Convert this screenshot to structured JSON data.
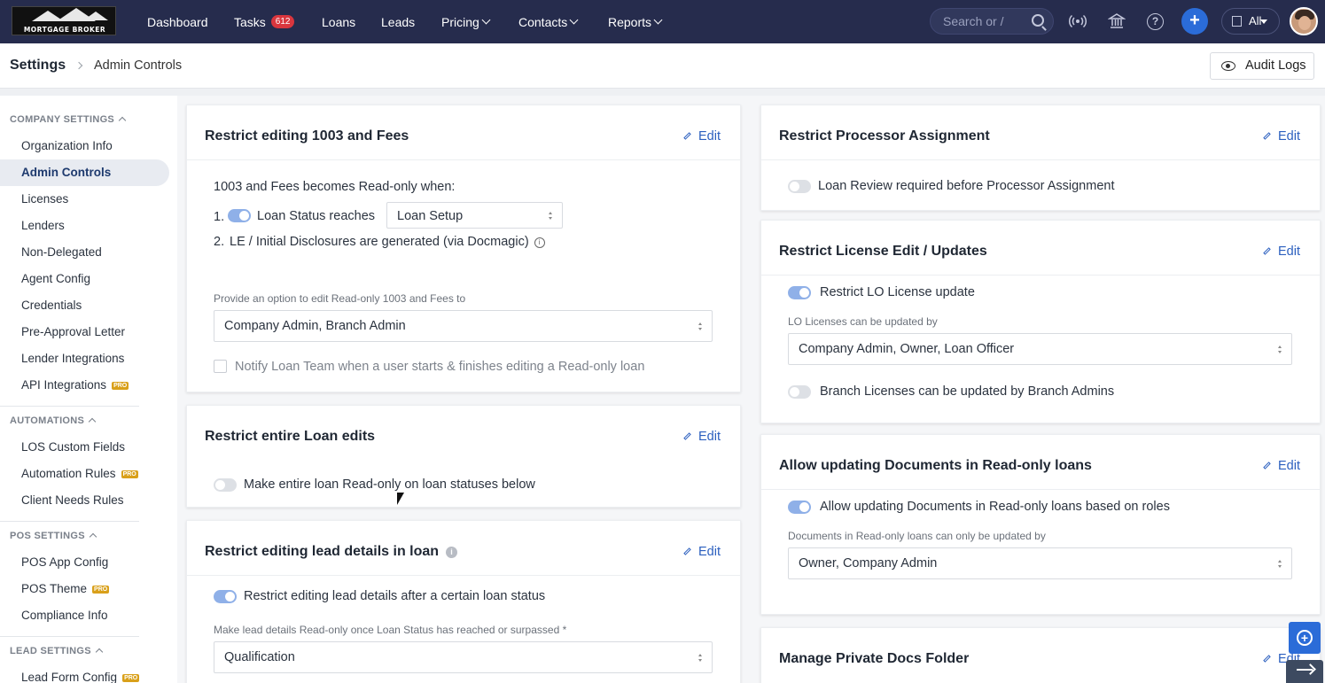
{
  "brand": {
    "logo_text": "MORTGAGE BROKER"
  },
  "nav": {
    "items": [
      {
        "label": "Dashboard"
      },
      {
        "label": "Tasks",
        "badge": "612"
      },
      {
        "label": "Loans"
      },
      {
        "label": "Leads"
      },
      {
        "label": "Pricing"
      },
      {
        "label": "Contacts"
      },
      {
        "label": "Reports"
      }
    ],
    "search_placeholder": "Search or /",
    "branch_filter": "All"
  },
  "breadcrumb": {
    "root": "Settings",
    "current": "Admin Controls"
  },
  "audit_logs_label": "Audit Logs",
  "sidebar": {
    "company_settings": {
      "header": "COMPANY SETTINGS",
      "items": [
        "Organization Info",
        "Admin Controls",
        "Licenses",
        "Lenders",
        "Non-Delegated",
        "Agent Config",
        "Credentials",
        "Pre-Approval Letter",
        "Lender Integrations",
        "API Integrations"
      ]
    },
    "automations": {
      "header": "AUTOMATIONS",
      "items": [
        "LOS Custom Fields",
        "Automation Rules",
        "Client Needs Rules"
      ]
    },
    "pos_settings": {
      "header": "POS SETTINGS",
      "items": [
        "POS App Config",
        "POS Theme",
        "Compliance Info"
      ]
    },
    "lead_settings": {
      "header": "LEAD SETTINGS",
      "items": [
        "Lead Form Config"
      ]
    },
    "pro_label": "PRO"
  },
  "edit_label": "Edit",
  "cards": {
    "restrict_1003": {
      "title": "Restrict editing 1003 and Fees",
      "intro": "1003 and Fees becomes Read-only when:",
      "cond1_num": "1.",
      "cond1_label": "Loan Status reaches",
      "cond1_value": "Loan Setup",
      "cond2_num": "2.",
      "cond2_label": "LE / Initial Disclosures are generated (via Docmagic)",
      "option_label": "Provide an option to edit Read-only 1003 and Fees to",
      "option_value": "Company Admin, Branch Admin",
      "notify_label": "Notify Loan Team when a user starts & finishes editing a Read-only loan"
    },
    "restrict_loan": {
      "title": "Restrict entire Loan edits",
      "toggle_label": "Make entire loan Read-only on loan statuses below"
    },
    "restrict_lead": {
      "title": "Restrict editing lead details in loan",
      "toggle_label": "Restrict editing lead details after a certain loan status",
      "status_label": "Make lead details Read-only once Loan Status has reached or surpassed *",
      "status_value": "Qualification"
    },
    "restrict_processor": {
      "title": "Restrict Processor Assignment",
      "toggle_label": "Loan Review required before Processor Assignment"
    },
    "restrict_license": {
      "title": "Restrict License Edit / Updates",
      "toggle_label": "Restrict LO License update",
      "by_label": "LO Licenses can be updated by",
      "by_value": "Company Admin, Owner, Loan Officer",
      "branch_label": "Branch Licenses can be updated by Branch Admins"
    },
    "allow_docs": {
      "title": "Allow updating Documents in Read-only loans",
      "toggle_label": "Allow updating Documents in Read-only loans based on roles",
      "by_label": "Documents in Read-only loans can only be updated by",
      "by_value": "Owner, Company Admin"
    },
    "private_docs": {
      "title": "Manage Private Docs Folder"
    }
  }
}
